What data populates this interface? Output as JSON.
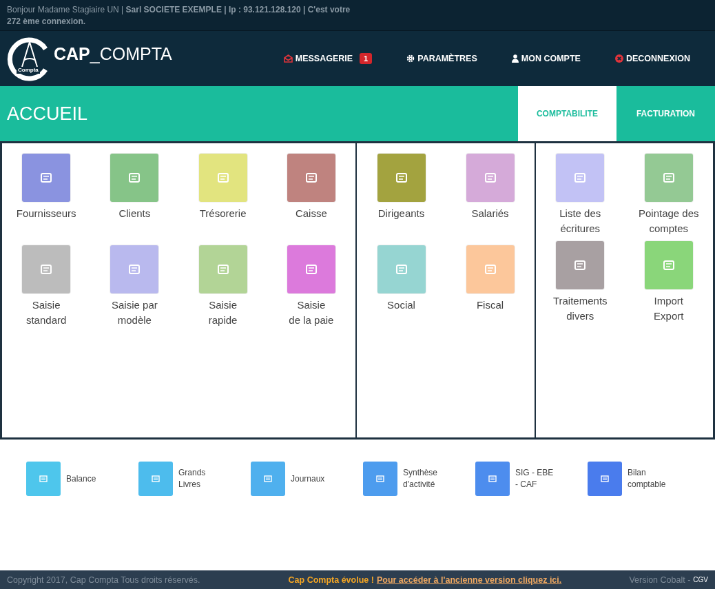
{
  "top_bar": {
    "greeting": "Bonjour Madame Stagiaire UN | **Sarl SOCIETE EXEMPLE | Ip : 93.121.128.120 | C'est votre 272 ème connexion.**"
  },
  "brand": {
    "logo_text": "Compta",
    "name_bold": "CAP",
    "name_light": "_COMPTA"
  },
  "nav": [
    {
      "label": "MESSAGERIE",
      "badge": "1",
      "kind": "mail"
    },
    {
      "label": "PARAMÈTRES",
      "kind": "gear"
    },
    {
      "label": "MON COMPTE",
      "kind": "user"
    },
    {
      "label": "DECONNEXION",
      "kind": "logout"
    }
  ],
  "page_title": "ACCUEIL",
  "tabs": [
    {
      "label": "COMPTABILITE",
      "selected": true
    },
    {
      "label": "FACTURATION",
      "selected": false
    }
  ],
  "panels": [
    {
      "tiles": [
        {
          "lines": [
            "Fournisseurs"
          ],
          "color": "#8a93e0"
        },
        {
          "lines": [
            "Clients"
          ],
          "color": "#86c488"
        },
        {
          "lines": [
            "Trésorerie"
          ],
          "color": "#e2e47f"
        },
        {
          "lines": [
            "Caisse"
          ],
          "color": "#bf837f"
        },
        {
          "lines": [
            "Saisie",
            "standard"
          ],
          "color": "#bcbcbc"
        },
        {
          "lines": [
            "Saisie par",
            "modèle"
          ],
          "color": "#b9b9ee"
        },
        {
          "lines": [
            "Saisie",
            "rapide"
          ],
          "color": "#b2d496"
        },
        {
          "lines": [
            "Saisie",
            "de la paie"
          ],
          "color": "#dc7adc"
        }
      ]
    },
    {
      "tiles": [
        {
          "lines": [
            "Dirigeants"
          ],
          "color": "#a3a33f"
        },
        {
          "lines": [
            "Salariés"
          ],
          "color": "#d5aad9"
        },
        {
          "lines": [
            "Social"
          ],
          "color": "#96d5d2"
        },
        {
          "lines": [
            "Fiscal"
          ],
          "color": "#fcc79b"
        }
      ]
    },
    {
      "tiles": [
        {
          "lines": [
            "Liste des",
            "écritures"
          ],
          "color": "#c2c2f5"
        },
        {
          "lines": [
            "Pointage des",
            "comptes"
          ],
          "color": "#94c994"
        },
        {
          "lines": [
            "Traitements",
            "divers"
          ],
          "color": "#a8a0a2"
        },
        {
          "lines": [
            "Import",
            "Export"
          ],
          "color": "#8ad67a"
        }
      ]
    }
  ],
  "reports": [
    {
      "lines": [
        "Balance"
      ],
      "color": "#4ec6ec"
    },
    {
      "lines": [
        "Grands",
        "Livres"
      ],
      "color": "#4dbced"
    },
    {
      "lines": [
        "Journaux"
      ],
      "color": "#4fb0ee"
    },
    {
      "lines": [
        "Synthèse",
        "d'activité"
      ],
      "color": "#4d9cee"
    },
    {
      "lines": [
        "SIG - EBE",
        "- CAF"
      ],
      "color": "#4d8dee"
    },
    {
      "lines": [
        "Bilan",
        "comptable"
      ],
      "color": "#4a7ced"
    }
  ],
  "footer": {
    "copyright": "Copyright 2017, Cap Compta Tous droits réservés.",
    "notice": "Cap Compta évolue !",
    "link": "Pour accéder à l'ancienne version cliquez ici.",
    "version": "Version Cobalt -",
    "cgv": "CGV"
  }
}
